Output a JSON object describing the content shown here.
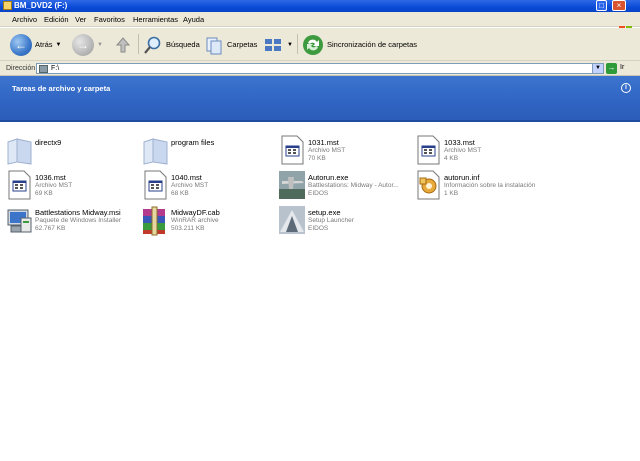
{
  "window": {
    "title": "BM_DVD2 (F:)"
  },
  "menu": [
    "Archivo",
    "Edición",
    "Ver",
    "Favoritos",
    "Herramientas",
    "Ayuda"
  ],
  "toolbar": {
    "back": "Atrás",
    "search": "Búsqueda",
    "folders": "Carpetas",
    "sync": "Sincronización de carpetas"
  },
  "address": {
    "label": "Dirección",
    "value": "F:\\",
    "go": "Ir"
  },
  "taskpane": {
    "title": "Tareas de archivo y carpeta"
  },
  "files": [
    {
      "name": "directx9",
      "line2": "",
      "line3": "",
      "icon": "folder-icon"
    },
    {
      "name": "program files",
      "line2": "",
      "line3": "",
      "icon": "folder-icon"
    },
    {
      "name": "1031.mst",
      "line2": "Archivo MST",
      "line3": "70 KB",
      "icon": "mst-file-icon"
    },
    {
      "name": "1033.mst",
      "line2": "Archivo MST",
      "line3": "4 KB",
      "icon": "mst-file-icon"
    },
    {
      "name": "1036.mst",
      "line2": "Archivo MST",
      "line3": "69 KB",
      "icon": "mst-file-icon"
    },
    {
      "name": "1040.mst",
      "line2": "Archivo MST",
      "line3": "68 KB",
      "icon": "mst-file-icon"
    },
    {
      "name": "Autorun.exe",
      "line2": "Battlestations: Midway - Autor...",
      "line3": "EIDOS",
      "icon": "aircraft-icon"
    },
    {
      "name": "autorun.inf",
      "line2": "Información sobre la instalación",
      "line3": "1 KB",
      "icon": "inf-file-icon"
    },
    {
      "name": "Battlestations Midway.msi",
      "line2": "Paquete de Windows Installer",
      "line3": "62.767 KB",
      "icon": "installer-icon"
    },
    {
      "name": "MidwayDF.cab",
      "line2": "WinRAR archive",
      "line3": "503.211 KB",
      "icon": "winrar-icon"
    },
    {
      "name": "setup.exe",
      "line2": "Setup Launcher",
      "line3": "EIDOS",
      "icon": "setup-launcher-icon"
    }
  ]
}
